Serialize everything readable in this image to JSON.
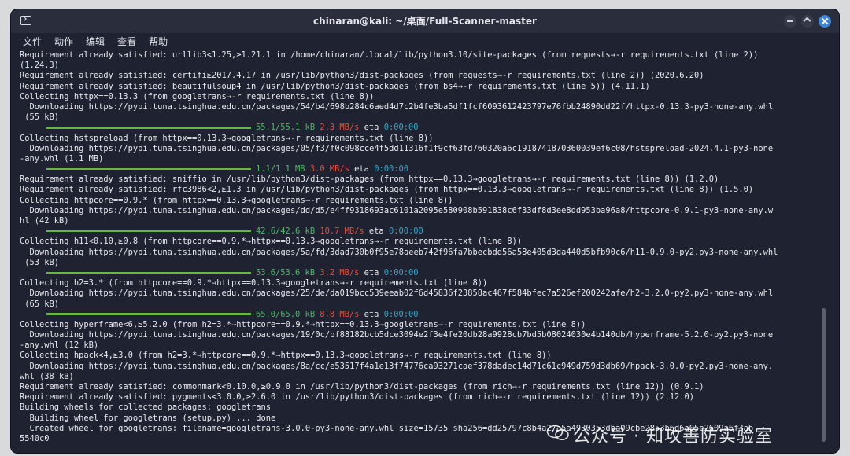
{
  "window": {
    "title": "chinaran@kali: ~/桌面/Full-Scanner-master"
  },
  "menu": [
    "文件",
    "动作",
    "编辑",
    "查看",
    "帮助"
  ],
  "lines": [
    {
      "text": "Requirement already satisfied: urllib3<1.25,≥1.21.1 in /home/chinaran/.local/lib/python3.10/site-packages (from requests→-r requirements.txt (line 2))"
    },
    {
      "text": "(1.24.3)"
    },
    {
      "text": "Requirement already satisfied: certifi≥2017.4.17 in /usr/lib/python3/dist-packages (from requests→-r requirements.txt (line 2)) (2020.6.20)"
    },
    {
      "text": "Requirement already satisfied: beautifulsoup4 in /usr/lib/python3/dist-packages (from bs4→-r requirements.txt (line 5)) (4.11.1)"
    },
    {
      "text": "Collecting httpx==0.13.3 (from googletrans→-r requirements.txt (line 8))"
    },
    {
      "text": "  Downloading https://pypi.tuna.tsinghua.edu.cn/packages/54/b4/698b284c6aed4d7c2b4fe3ba5df1fcf6093612423797e76fbb24890dd22f/httpx-0.13.3-py3-none-any.whl"
    },
    {
      "text": " (55 kB)"
    },
    {
      "progress": {
        "done": "55.1/55.1 kB",
        "speed": "2.3 MB/s",
        "eta_label": "eta",
        "eta": "0:00:00"
      }
    },
    {
      "text": "Collecting hstspreload (from httpx==0.13.3→googletrans→-r requirements.txt (line 8))"
    },
    {
      "text": "  Downloading https://pypi.tuna.tsinghua.edu.cn/packages/05/f3/f0c098cce4f5dd11316f1f9cf63fd760320a6c1918741870360039ef6c08/hstspreload-2024.4.1-py3-none"
    },
    {
      "text": "-any.whl (1.1 MB)"
    },
    {
      "progress": {
        "done": "1.1/1.1 MB",
        "speed": "3.0 MB/s",
        "eta_label": "eta",
        "eta": "0:00:00"
      }
    },
    {
      "text": "Requirement already satisfied: sniffio in /usr/lib/python3/dist-packages (from httpx==0.13.3→googletrans→-r requirements.txt (line 8)) (1.2.0)"
    },
    {
      "text": "Requirement already satisfied: rfc3986<2,≥1.3 in /usr/lib/python3/dist-packages (from httpx==0.13.3→googletrans→-r requirements.txt (line 8)) (1.5.0)"
    },
    {
      "text": "Collecting httpcore==0.9.* (from httpx==0.13.3→googletrans→-r requirements.txt (line 8))"
    },
    {
      "text": "  Downloading https://pypi.tuna.tsinghua.edu.cn/packages/dd/d5/e4ff9318693ac6101a2095e580908b591838c6f33df8d3ee8dd953ba96a8/httpcore-0.9.1-py3-none-any.w"
    },
    {
      "text": "hl (42 kB)"
    },
    {
      "progress": {
        "done": "42.6/42.6 kB",
        "speed": "10.7 MB/s",
        "eta_label": "eta",
        "eta": "0:00:00"
      }
    },
    {
      "text": "Collecting h11<0.10,≥0.8 (from httpcore==0.9.*→httpx==0.13.3→googletrans→-r requirements.txt (line 8))"
    },
    {
      "text": "  Downloading https://pypi.tuna.tsinghua.edu.cn/packages/5a/fd/3dad730b0f95e78aeeb742f96fa7bbecbdd56a58e405d3da440d5bfb90c6/h11-0.9.0-py2.py3-none-any.whl"
    },
    {
      "text": " (53 kB)"
    },
    {
      "progress": {
        "done": "53.6/53.6 kB",
        "speed": "3.2 MB/s",
        "eta_label": "eta",
        "eta": "0:00:00"
      }
    },
    {
      "text": "Collecting h2=3.* (from httpcore==0.9.*→httpx==0.13.3→googletrans→-r requirements.txt (line 8))"
    },
    {
      "text": "  Downloading https://pypi.tuna.tsinghua.edu.cn/packages/25/de/da019bcc539eeab02f6d45836f23858ac467f584bfec7a526ef200242afe/h2-3.2.0-py2.py3-none-any.whl"
    },
    {
      "text": " (65 kB)"
    },
    {
      "progress": {
        "done": "65.0/65.0 kB",
        "speed": "8.8 MB/s",
        "eta_label": "eta",
        "eta": "0:00:00"
      }
    },
    {
      "text": "Collecting hyperframe<6,≥5.2.0 (from h2=3.*→httpcore==0.9.*→httpx==0.13.3→googletrans→-r requirements.txt (line 8))"
    },
    {
      "text": "  Downloading https://pypi.tuna.tsinghua.edu.cn/packages/19/0c/bf88182bcb5dce3094e2f3e4fe20db28a9928cb7bd5b08024030e4b140db/hyperframe-5.2.0-py2.py3-none"
    },
    {
      "text": "-any.whl (12 kB)"
    },
    {
      "text": "Collecting hpack<4,≥3.0 (from h2=3.*→httpcore==0.9.*→httpx==0.13.3→googletrans→-r requirements.txt (line 8))"
    },
    {
      "text": "  Downloading https://pypi.tuna.tsinghua.edu.cn/packages/8a/cc/e53517f4a1e13f74776ca93271caef378dadec14d71c61c949d759d3db69/hpack-3.0.0-py2.py3-none-any."
    },
    {
      "text": "whl (38 kB)"
    },
    {
      "text": "Requirement already satisfied: commonmark<0.10.0,≥0.9.0 in /usr/lib/python3/dist-packages (from rich→-r requirements.txt (line 12)) (0.9.1)"
    },
    {
      "text": "Requirement already satisfied: pygments<3.0.0,≥2.6.0 in /usr/lib/python3/dist-packages (from rich→-r requirements.txt (line 12)) (2.12.0)"
    },
    {
      "text": "Building wheels for collected packages: googletrans"
    },
    {
      "text": "  Building wheel for googletrans (setup.py) ... done"
    },
    {
      "text": "  Created wheel for googletrans: filename=googletrans-3.0.0-py3-none-any.whl size=15735 sha256=dd25797c8b4a27a5a4930353dba09cbe2853b6d6a05e2609a6f3ab"
    },
    {
      "text": "5540c0"
    }
  ],
  "watermark": {
    "text": "公众号 · 知攻善防实验室"
  },
  "colors": {
    "green": "#4fb86b",
    "red": "#e3503c",
    "cyan": "#36a4c4",
    "bar": "#64b83c"
  }
}
